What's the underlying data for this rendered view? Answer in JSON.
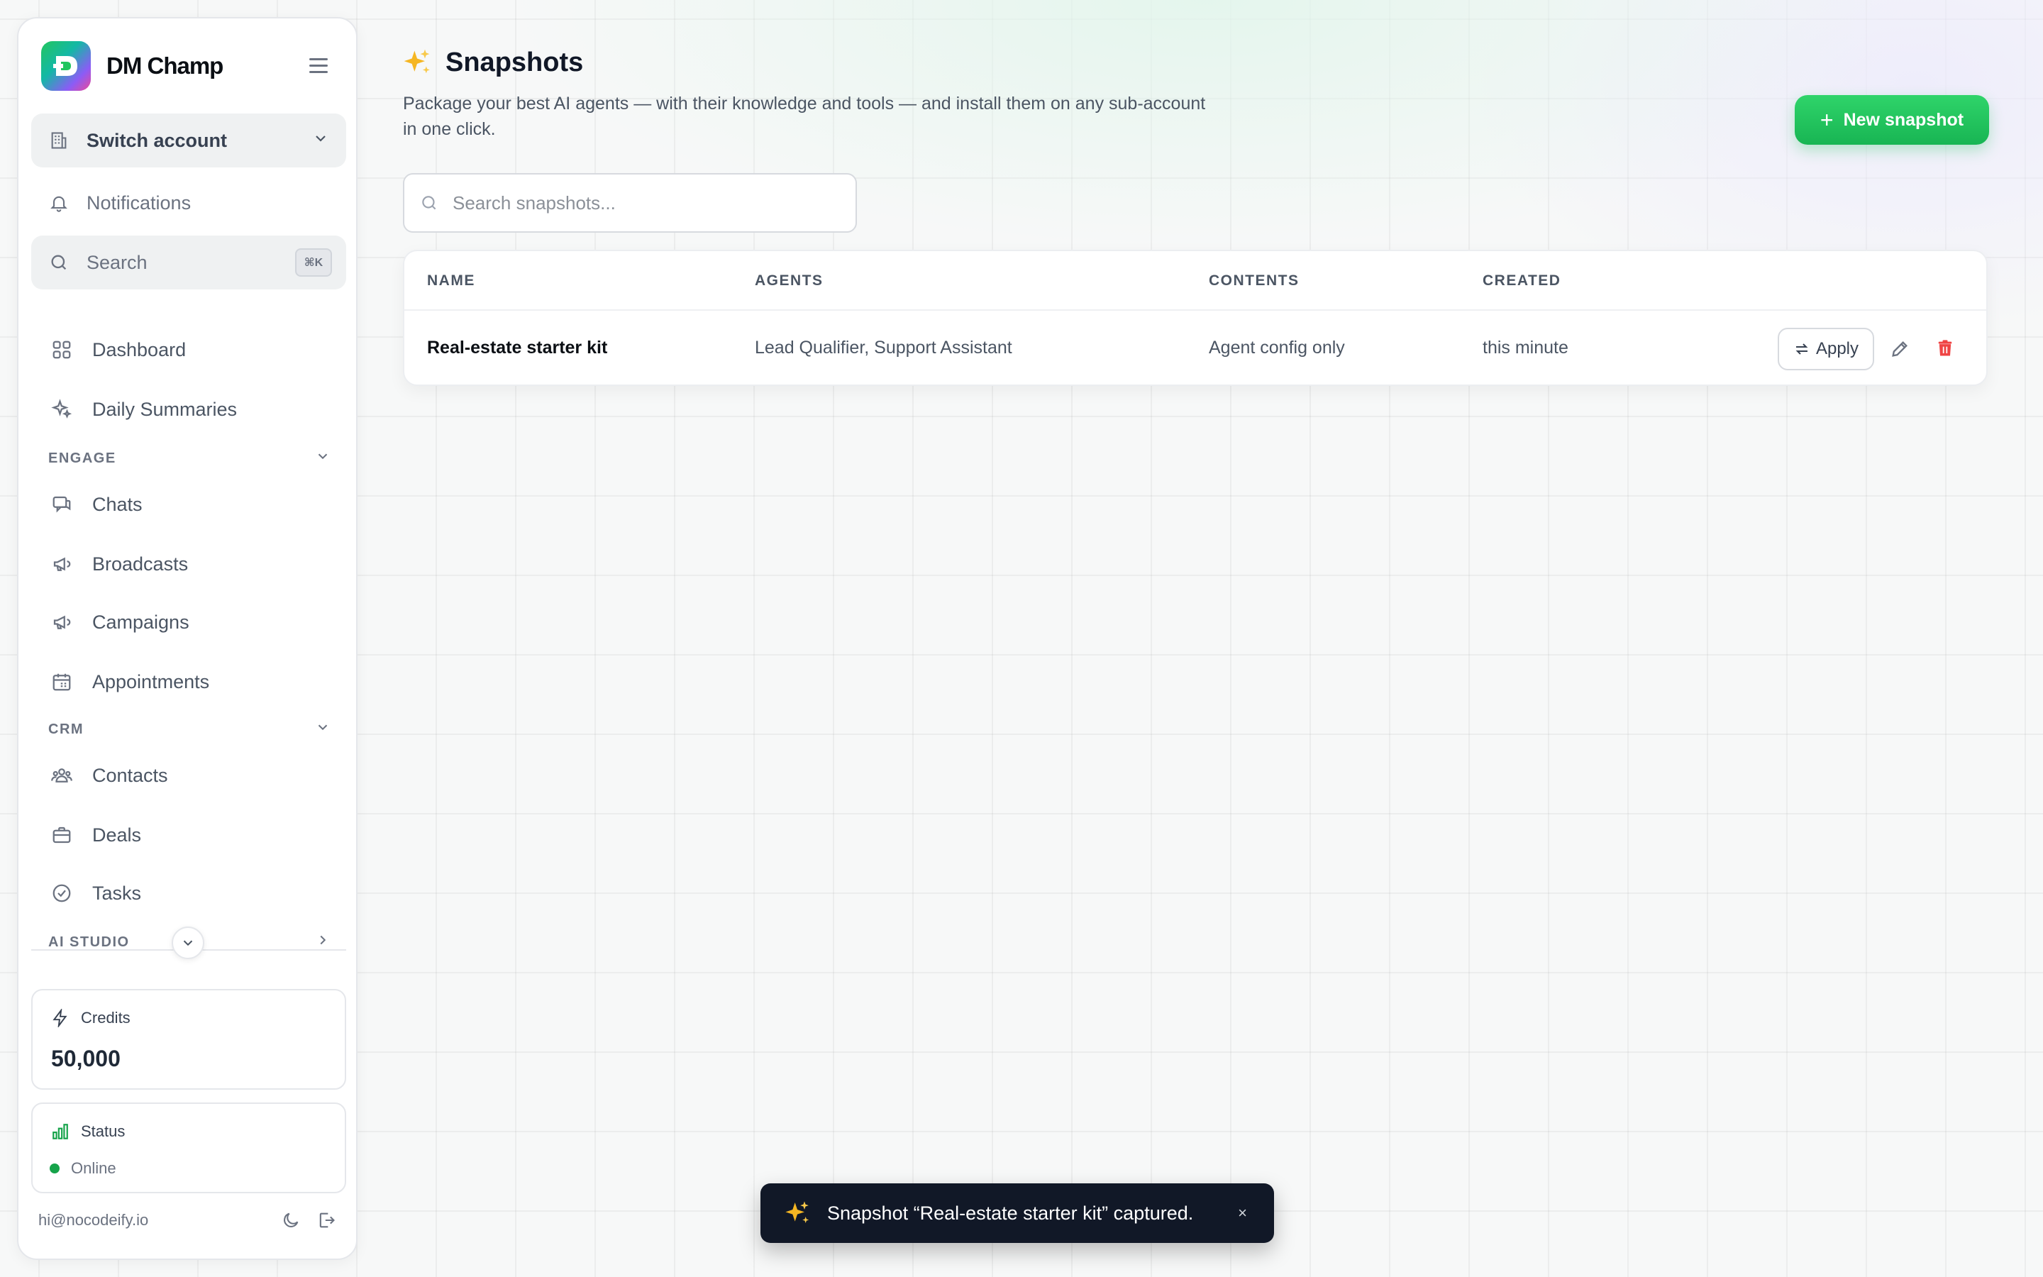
{
  "brand": {
    "name": "DM Champ"
  },
  "sidebar": {
    "switch_account": "Switch account",
    "notifications": "Notifications",
    "search_label": "Search",
    "search_kbd": "⌘K",
    "items": [
      {
        "label": "Dashboard",
        "icon": "grid-icon"
      },
      {
        "label": "Daily Summaries",
        "icon": "sparkles-icon"
      }
    ],
    "sections": [
      {
        "title": "ENGAGE",
        "items": [
          {
            "label": "Chats",
            "icon": "chat-icon"
          },
          {
            "label": "Broadcasts",
            "icon": "megaphone-icon"
          },
          {
            "label": "Campaigns",
            "icon": "megaphone-icon"
          },
          {
            "label": "Appointments",
            "icon": "calendar-icon"
          }
        ]
      },
      {
        "title": "CRM",
        "items": [
          {
            "label": "Contacts",
            "icon": "users-icon"
          },
          {
            "label": "Deals",
            "icon": "briefcase-icon"
          },
          {
            "label": "Tasks",
            "icon": "check-circle-icon"
          }
        ]
      },
      {
        "title": "AI STUDIO",
        "items": []
      }
    ],
    "credits": {
      "label": "Credits",
      "value": "50,000"
    },
    "status": {
      "label": "Status",
      "value": "Online",
      "color": "#16a34a"
    },
    "footer": {
      "email": "hi@nocodeify.io"
    }
  },
  "main": {
    "title": "Snapshots",
    "description": "Package your best AI agents — with their knowledge and tools — and install them on any sub-account in one click.",
    "new_button": "New snapshot",
    "search_placeholder": "Search snapshots...",
    "table": {
      "columns": [
        "NAME",
        "AGENTS",
        "CONTENTS",
        "CREATED"
      ],
      "rows": [
        {
          "name": "Real-estate starter kit",
          "agents": "Lead Qualifier, Support Assistant",
          "contents": "Agent config only",
          "created": "this minute",
          "apply": "Apply"
        }
      ]
    }
  },
  "toast": {
    "message": "Snapshot “Real-estate starter kit” captured.",
    "close": "×"
  },
  "colors": {
    "accent": "#22c55e",
    "danger": "#ef4444",
    "toast_bg": "#111827"
  }
}
